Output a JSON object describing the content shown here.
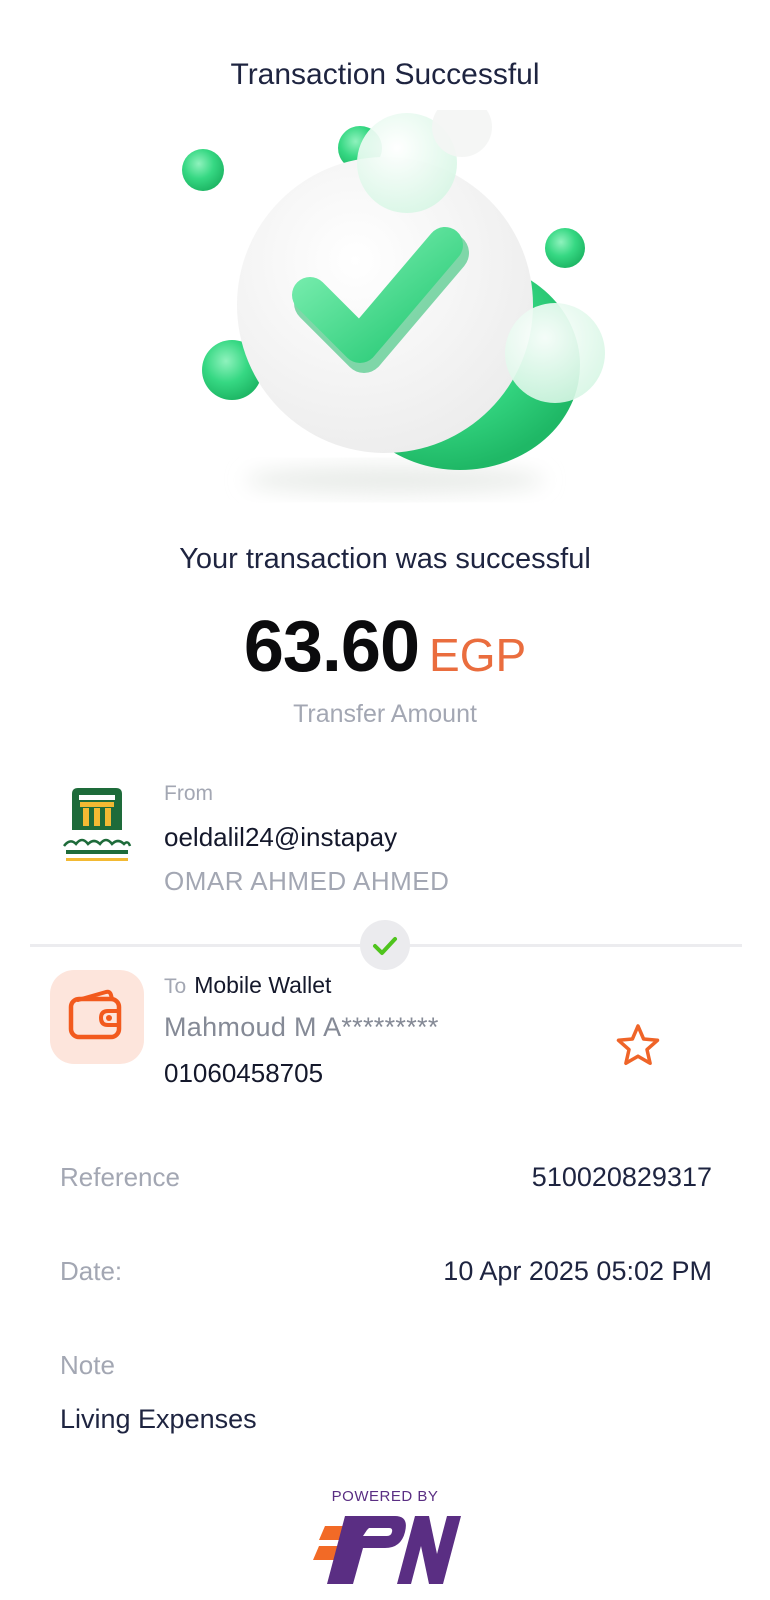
{
  "header": {
    "title": "Transaction Successful"
  },
  "result": {
    "headline": "Your transaction was successful",
    "amount": "63.60",
    "currency": "EGP",
    "amount_caption": "Transfer Amount"
  },
  "sender": {
    "label": "From",
    "handle": "oeldalil24@instapay",
    "name": "OMAR AHMED AHMED",
    "logo_icon": "bank-logo"
  },
  "recipient": {
    "label": "To",
    "type": "Mobile Wallet",
    "name": "Mahmoud M A*********",
    "number": "01060458705",
    "icon": "wallet-icon"
  },
  "details": {
    "reference_label": "Reference",
    "reference_value": "510020829317",
    "date_label": "Date:",
    "date_value": "10 Apr 2025 05:02 PM",
    "note_label": "Note",
    "note_value": "Living Expenses"
  },
  "footer": {
    "powered_by": "POWERED BY",
    "brand_icon": "ipn-logo"
  },
  "colors": {
    "accent": "#ea6d3e",
    "success": "#2fd17a",
    "brand_purple": "#5a2e83",
    "bank_green": "#1e6b3a"
  }
}
